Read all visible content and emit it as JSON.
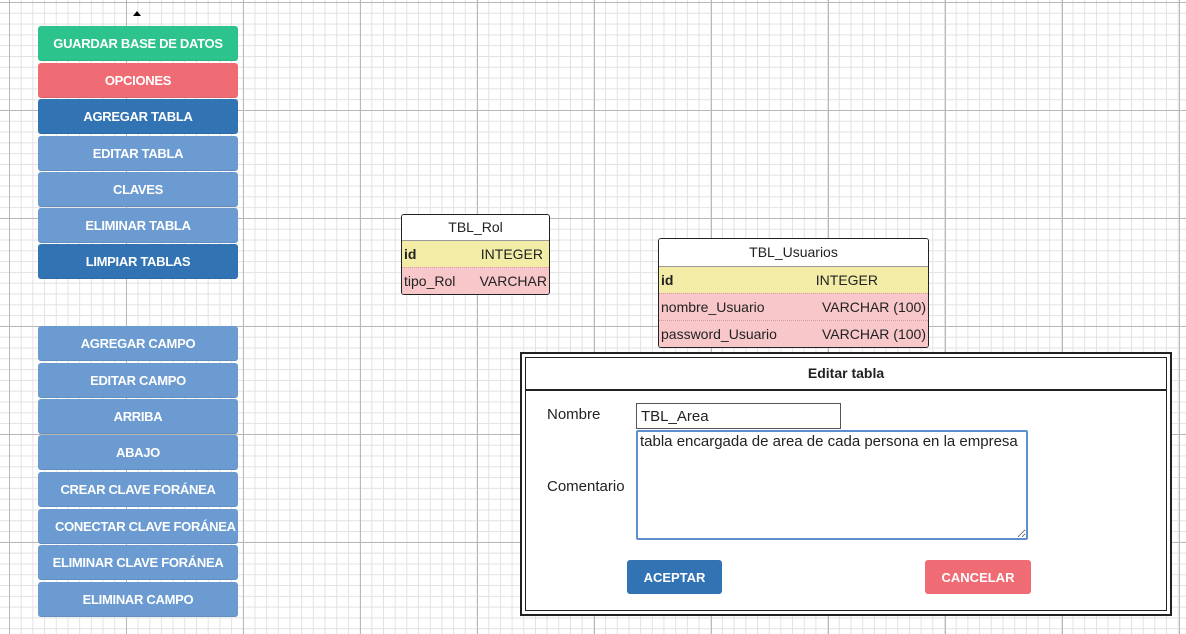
{
  "sidebar": {
    "top_buttons": [
      {
        "label": "GUARDAR BASE DE DATOS",
        "style": "green"
      },
      {
        "label": "OPCIONES",
        "style": "red"
      },
      {
        "label": "AGREGAR TABLA",
        "style": "blue"
      },
      {
        "label": "EDITAR TABLA",
        "style": "light"
      },
      {
        "label": "CLAVES",
        "style": "light"
      },
      {
        "label": "ELIMINAR TABLA",
        "style": "light"
      },
      {
        "label": "LIMPIAR TABLAS",
        "style": "blue"
      }
    ],
    "field_buttons": [
      {
        "label": "AGREGAR CAMPO"
      },
      {
        "label": "EDITAR CAMPO"
      },
      {
        "label": "ARRIBA"
      },
      {
        "label": "ABAJO"
      },
      {
        "label": "CREAR CLAVE FORÁNEA"
      },
      {
        "label": "CONECTAR CLAVE FORÁNEA"
      },
      {
        "label": "ELIMINAR CLAVE FORÁNEA"
      },
      {
        "label": "ELIMINAR CAMPO"
      }
    ]
  },
  "tables": [
    {
      "name": "TBL_Rol",
      "fields": [
        {
          "name": "id",
          "type": "INTEGER",
          "primary": true
        },
        {
          "name": "tipo_Rol",
          "type": "VARCHAR",
          "primary": false
        }
      ]
    },
    {
      "name": "TBL_Usuarios",
      "fields": [
        {
          "name": "id",
          "type": "INTEGER",
          "primary": true
        },
        {
          "name": "nombre_Usuario",
          "type": "VARCHAR (100)",
          "primary": false
        },
        {
          "name": "password_Usuario",
          "type": "VARCHAR (100)",
          "primary": false
        }
      ]
    }
  ],
  "dialog": {
    "title": "Editar tabla",
    "name_label": "Nombre",
    "name_value": "TBL_Area",
    "comment_label": "Comentario",
    "comment_value": "tabla encargada de area de cada persona en la empresa",
    "accept_label": "ACEPTAR",
    "cancel_label": "CANCELAR"
  },
  "colors": {
    "green": "#2cc38c",
    "red": "#ef6c74",
    "blue": "#3273b4",
    "light_blue": "#6b9bd1",
    "pk_row": "#f2eca6",
    "field_row": "#f7c7c9"
  }
}
